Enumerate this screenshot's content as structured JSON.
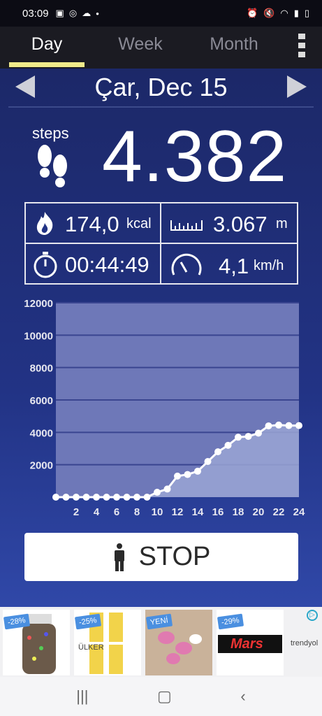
{
  "status": {
    "time": "03:09",
    "icons": [
      "image-icon",
      "instagram-icon",
      "cloud-icon",
      "dot-icon"
    ],
    "right_icons": [
      "alarm-icon",
      "mute-icon",
      "wifi-icon",
      "signal-icon",
      "battery-icon"
    ]
  },
  "tabs": [
    {
      "label": "Day",
      "active": true
    },
    {
      "label": "Week"
    },
    {
      "label": "Month"
    }
  ],
  "date": {
    "title": "Çar, Dec 15"
  },
  "steps": {
    "label": "steps",
    "value": "4.382"
  },
  "stats": {
    "calories": {
      "value": "174,0",
      "unit": "kcal"
    },
    "distance": {
      "value": "3.067",
      "unit": "m"
    },
    "duration": {
      "value": "00:44:49"
    },
    "speed": {
      "value": "4,1",
      "unit": "km/h"
    }
  },
  "chart_data": {
    "type": "area",
    "x": [
      0,
      1,
      2,
      3,
      4,
      5,
      6,
      7,
      8,
      9,
      10,
      11,
      12,
      13,
      14,
      15,
      16,
      17,
      18,
      19,
      20,
      21,
      22,
      23,
      24
    ],
    "y": [
      0,
      0,
      0,
      0,
      0,
      0,
      0,
      0,
      0,
      0,
      300,
      500,
      1300,
      1400,
      1600,
      2200,
      2800,
      3200,
      3700,
      3750,
      3950,
      4400,
      4450,
      4420,
      4420
    ],
    "xticks": [
      2,
      4,
      6,
      8,
      10,
      12,
      14,
      16,
      18,
      20,
      22,
      24
    ],
    "yticks": [
      2000,
      4000,
      6000,
      8000,
      10000,
      12000
    ],
    "ylim": [
      0,
      12000
    ],
    "xlim": [
      0,
      24
    ],
    "grid": true
  },
  "stop_button": {
    "label": "STOP"
  },
  "ads": [
    {
      "tag": "-28%"
    },
    {
      "tag": "-25%",
      "brand": "ÜLKER"
    },
    {
      "tag": "YENİ"
    },
    {
      "tag": "-29%",
      "brand": "Mars"
    }
  ],
  "ad_brand": "trendyol",
  "colors": {
    "accent": "#f0eb8a",
    "background": "#223385",
    "chart_fill": "#9aa5d4",
    "chart_panel": "#6e78b8"
  }
}
